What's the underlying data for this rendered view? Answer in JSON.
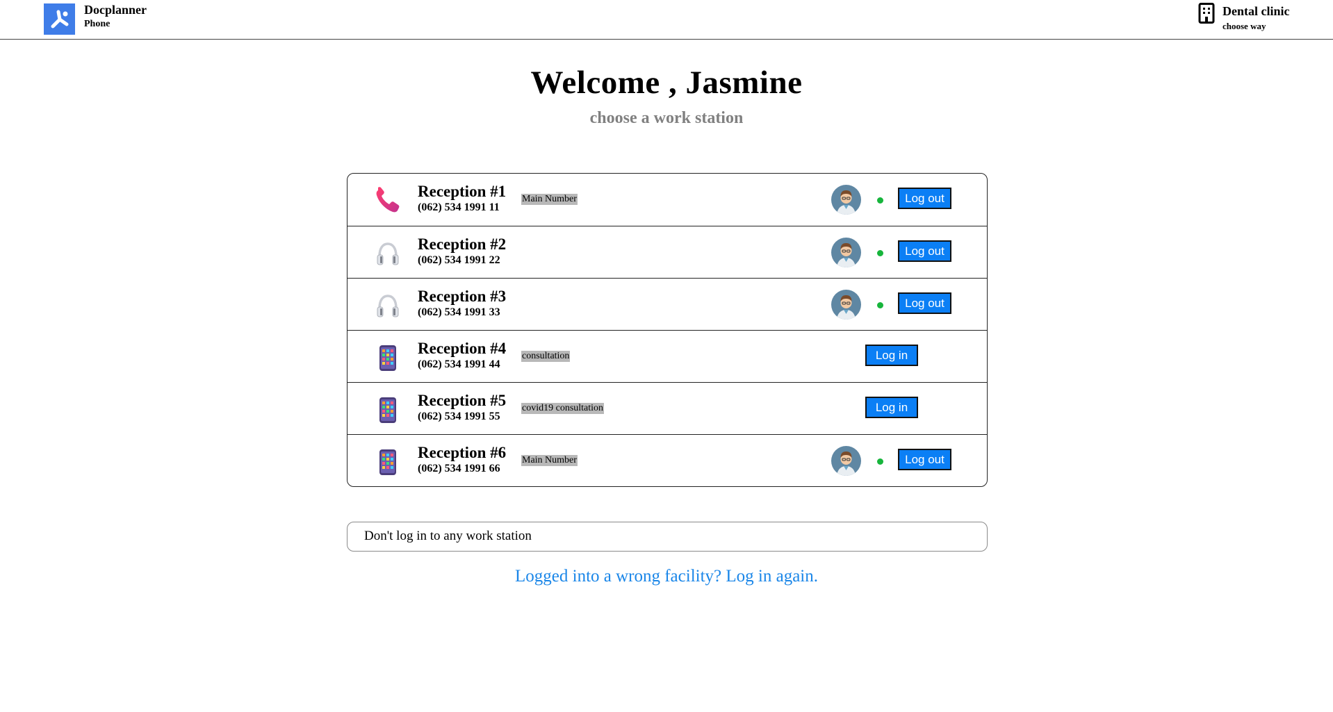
{
  "header": {
    "brand_name": "Docplanner",
    "brand_sub": "Phone",
    "brand_logo_icon": "docplanner-logo-icon",
    "clinic_name": "Dental clinic",
    "clinic_sub": "choose way",
    "clinic_icon": "building-icon",
    "accent_color": "#3f7de8"
  },
  "main": {
    "welcome": "Welcome , Jasmine",
    "subtitle": "choose a work station"
  },
  "stations": [
    {
      "title": "Reception #1",
      "phone": "(062) 534 1991 11",
      "tag": "Main Number",
      "icon": "phone-handset-icon",
      "logged_in": true,
      "button": "Log out"
    },
    {
      "title": "Reception #2",
      "phone": "(062) 534 1991 22",
      "tag": "",
      "icon": "headphones-icon",
      "logged_in": true,
      "button": "Log out"
    },
    {
      "title": "Reception #3",
      "phone": "(062) 534 1991 33",
      "tag": "",
      "icon": "headphones-icon",
      "logged_in": true,
      "button": "Log out"
    },
    {
      "title": "Reception #4",
      "phone": "(062) 534 1991 44",
      "tag": "consultation",
      "icon": "mobile-phone-icon",
      "logged_in": false,
      "button": "Log in"
    },
    {
      "title": "Reception #5",
      "phone": "(062) 534 1991 55",
      "tag": "covid19 consultation",
      "icon": "mobile-phone-icon",
      "logged_in": false,
      "button": "Log in"
    },
    {
      "title": "Reception #6",
      "phone": "(062) 534 1991 66",
      "tag": "Main Number",
      "icon": "mobile-phone-icon",
      "logged_in": true,
      "button": "Log out"
    }
  ],
  "footer": {
    "no_login": "Don't log in to any work station",
    "relogin_link": "Logged into a wrong facility? Log in again."
  },
  "colors": {
    "button": "#0b7ff5",
    "status_online": "#17b53c",
    "link": "#1a86e8",
    "subtitle": "#808080"
  }
}
